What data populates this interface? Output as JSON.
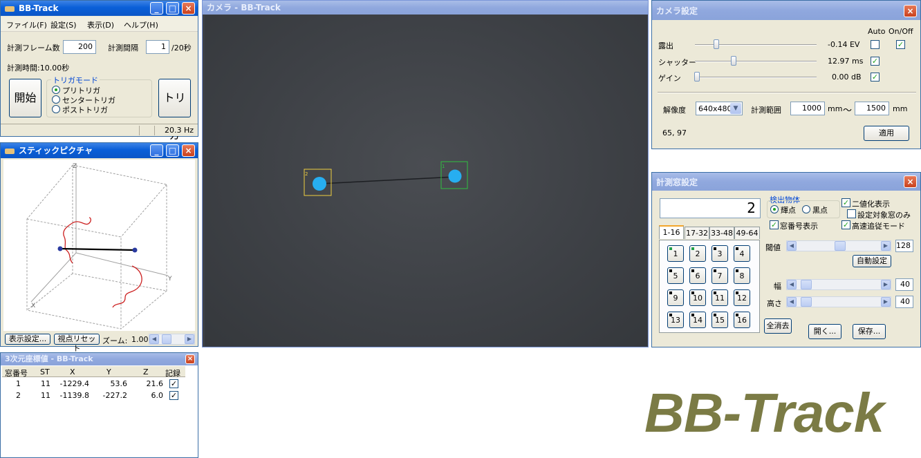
{
  "main_window": {
    "title": "BB-Track",
    "menu": [
      "ファイル(F)",
      "設定(S)",
      "表示(D)",
      "ヘルプ(H)"
    ],
    "frame_count_label": "計測フレーム数",
    "frame_count_value": "200",
    "interval_label": "計測間隔",
    "interval_value": "1",
    "interval_unit": "/20秒",
    "duration_text": "計測時間:10.00秒",
    "start_button": "開始",
    "trigger_group_label": "トリガモード",
    "trigger_options": [
      "プリトリガ",
      "センタートリガ",
      "ポストトリガ"
    ],
    "trigger_selected": 0,
    "trigger_button": "トリガ",
    "status_rate": "20.3 Hz"
  },
  "stick_window": {
    "title": "スティックピクチャ",
    "axis_labels": [
      "Z",
      "Y",
      "X"
    ],
    "display_settings_button": "表示設定...",
    "viewpoint_reset_button": "視点リセット",
    "zoom_label": "ズーム:",
    "zoom_value": "1.00"
  },
  "coord_window": {
    "title": "3次元座標値 - BB-Track",
    "columns": [
      "窓番号",
      "ST",
      "X",
      "Y",
      "Z",
      "記録"
    ],
    "rows": [
      {
        "no": "1",
        "st": "11",
        "x": "-1229.4",
        "y": "53.6",
        "z": "21.6",
        "rec": true
      },
      {
        "no": "2",
        "st": "11",
        "x": "-1139.8",
        "y": "-227.2",
        "z": "6.0",
        "rec": true
      }
    ]
  },
  "camera_window": {
    "title": "カメラ - BB-Track",
    "markers": [
      {
        "label": "2",
        "color": "#f0d040"
      },
      {
        "label": "1",
        "color": "#30c040"
      }
    ]
  },
  "camera_settings": {
    "title": "カメラ設定",
    "col_auto": "Auto",
    "col_onoff": "On/Off",
    "exposure_label": "露出",
    "exposure_value": "-0.14 EV",
    "shutter_label": "シャッター",
    "shutter_value": "12.97 ms",
    "gain_label": "ゲイン",
    "gain_value": "0.00 dB",
    "resolution_label": "解像度",
    "resolution_value": "640x480",
    "range_label": "計測範囲",
    "range_min": "1000",
    "range_min_unit": "mm",
    "range_tilde": "〜",
    "range_max": "1500",
    "range_max_unit": "mm",
    "cursor_pos": "65, 97",
    "apply_button": "適用"
  },
  "window_settings": {
    "title": "計測窓設定",
    "count_display": "2",
    "detect_label": "検出物体",
    "bright_label": "輝点",
    "dark_label": "黒点",
    "binary_label": "二値化表示",
    "target_only_label": "設定対象窓のみ",
    "window_no_label": "窓番号表示",
    "fast_track_label": "高速追従モード",
    "tabs": [
      "1-16",
      "17-32",
      "33-48",
      "49-64"
    ],
    "numbers": [
      "1",
      "2",
      "3",
      "4",
      "5",
      "6",
      "7",
      "8",
      "9",
      "10",
      "11",
      "12",
      "13",
      "14",
      "15",
      "16"
    ],
    "threshold_label": "閾値",
    "threshold_value": "128",
    "auto_button": "自動設定",
    "width_label": "幅",
    "width_value": "40",
    "height_label": "高さ",
    "height_value": "40",
    "clear_all_button": "全消去",
    "open_button": "開く...",
    "save_button": "保存..."
  },
  "brand": {
    "logo_text": "BB-Track",
    "logo_color": "#7b7b45"
  }
}
